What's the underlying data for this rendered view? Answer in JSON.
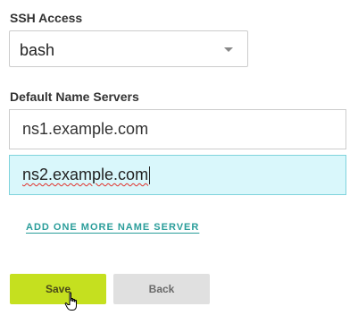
{
  "ssh_access": {
    "label": "SSH Access",
    "selected": "bash"
  },
  "name_servers": {
    "label": "Default Name Servers",
    "ns1": "ns1.example.com",
    "ns2": "ns2.example.com",
    "add_link": "ADD ONE MORE NAME SERVER"
  },
  "actions": {
    "save_label": "Save",
    "back_label": "Back"
  },
  "colors": {
    "save_bg": "#c5e01f",
    "back_bg": "#e0e0e0",
    "focused_input_bg": "#d9f7fb",
    "link": "#2a9d9a"
  }
}
